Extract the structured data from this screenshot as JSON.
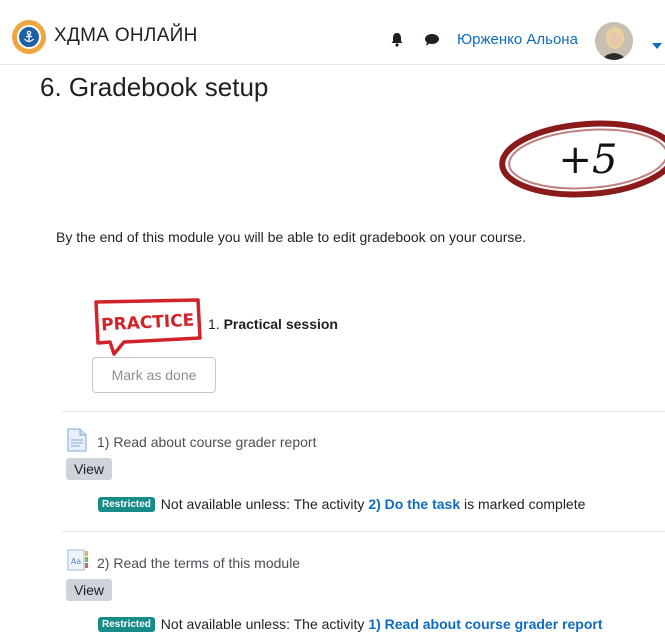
{
  "navbar": {
    "brand": "ХДМА ОНЛАЙН",
    "user_name": "Юрженко Альона"
  },
  "page": {
    "title": "6. Gradebook setup",
    "stamp_text": "+5",
    "intro": "By the end of this module you will be able to edit gradebook on your course."
  },
  "session": {
    "practice_label": "PRACTICE",
    "number": "1.",
    "name": "Practical session",
    "mark_done": "Mark as done"
  },
  "activities": [
    {
      "name": "1) Read about course grader report",
      "view_label": "View",
      "badge": "Restricted",
      "prefix": "Not available unless: The activity",
      "link": "2) Do the task",
      "suffix": "is marked complete"
    },
    {
      "name": "2) Read the terms of this module",
      "view_label": "View",
      "badge": "Restricted",
      "prefix": "Not available unless: The activity",
      "link": "1) Read about course grader report",
      "suffix": ""
    }
  ],
  "colors": {
    "link": "#0f6cbf",
    "badge": "#178a8a",
    "stamp": "#8b1a1a",
    "practice": "#d2232a"
  }
}
